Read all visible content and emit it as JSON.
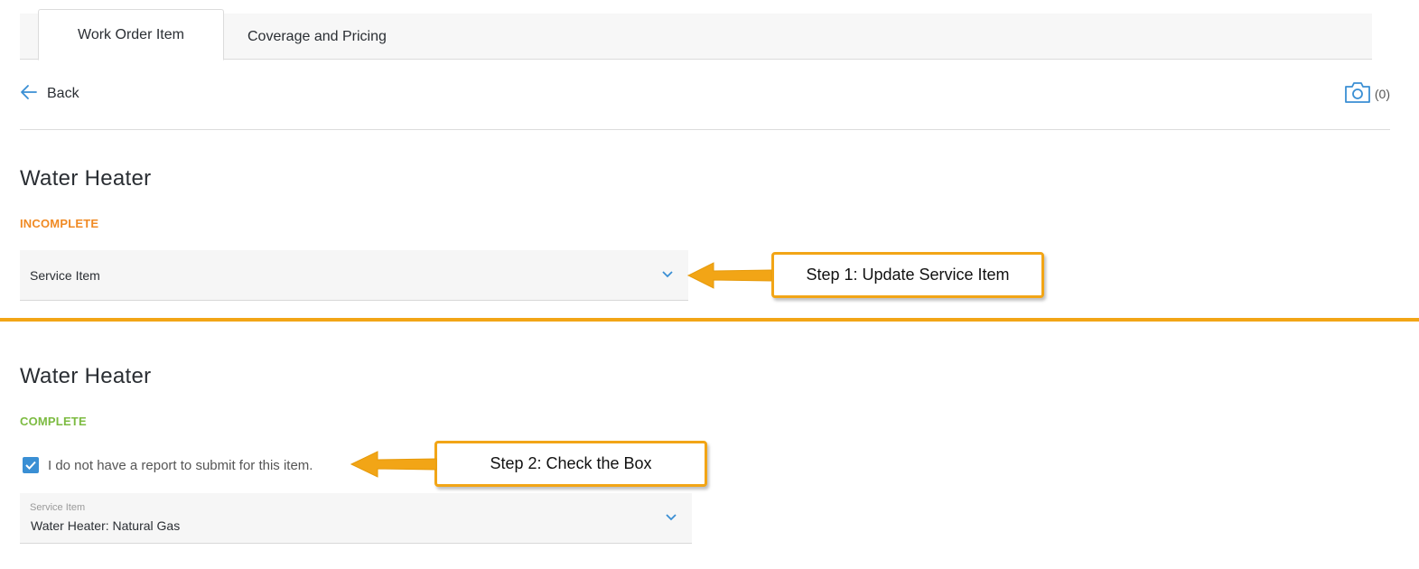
{
  "tabs": [
    {
      "label": "Work Order Item",
      "active": true
    },
    {
      "label": "Coverage and Pricing",
      "active": false
    }
  ],
  "nav": {
    "back_label": "Back"
  },
  "photos": {
    "count_label": "(0)",
    "icon": "camera-icon"
  },
  "section1": {
    "title": "Water Heater",
    "status": "INCOMPLETE",
    "select_label": "Service Item"
  },
  "section2": {
    "title": "Water Heater",
    "status": "COMPLETE",
    "checkbox_label": "I do not have a report to submit for this item.",
    "checkbox_checked": true,
    "select_label": "Service Item",
    "select_value": "Water Heater: Natural Gas"
  },
  "callouts": {
    "step1": "Step 1: Update Service Item",
    "step2": "Step 2: Check the Box"
  },
  "colors": {
    "accent_blue": "#3a8fd4",
    "incomplete": "#f08a24",
    "complete": "#7cbb41",
    "callout_orange": "#f2a516"
  }
}
